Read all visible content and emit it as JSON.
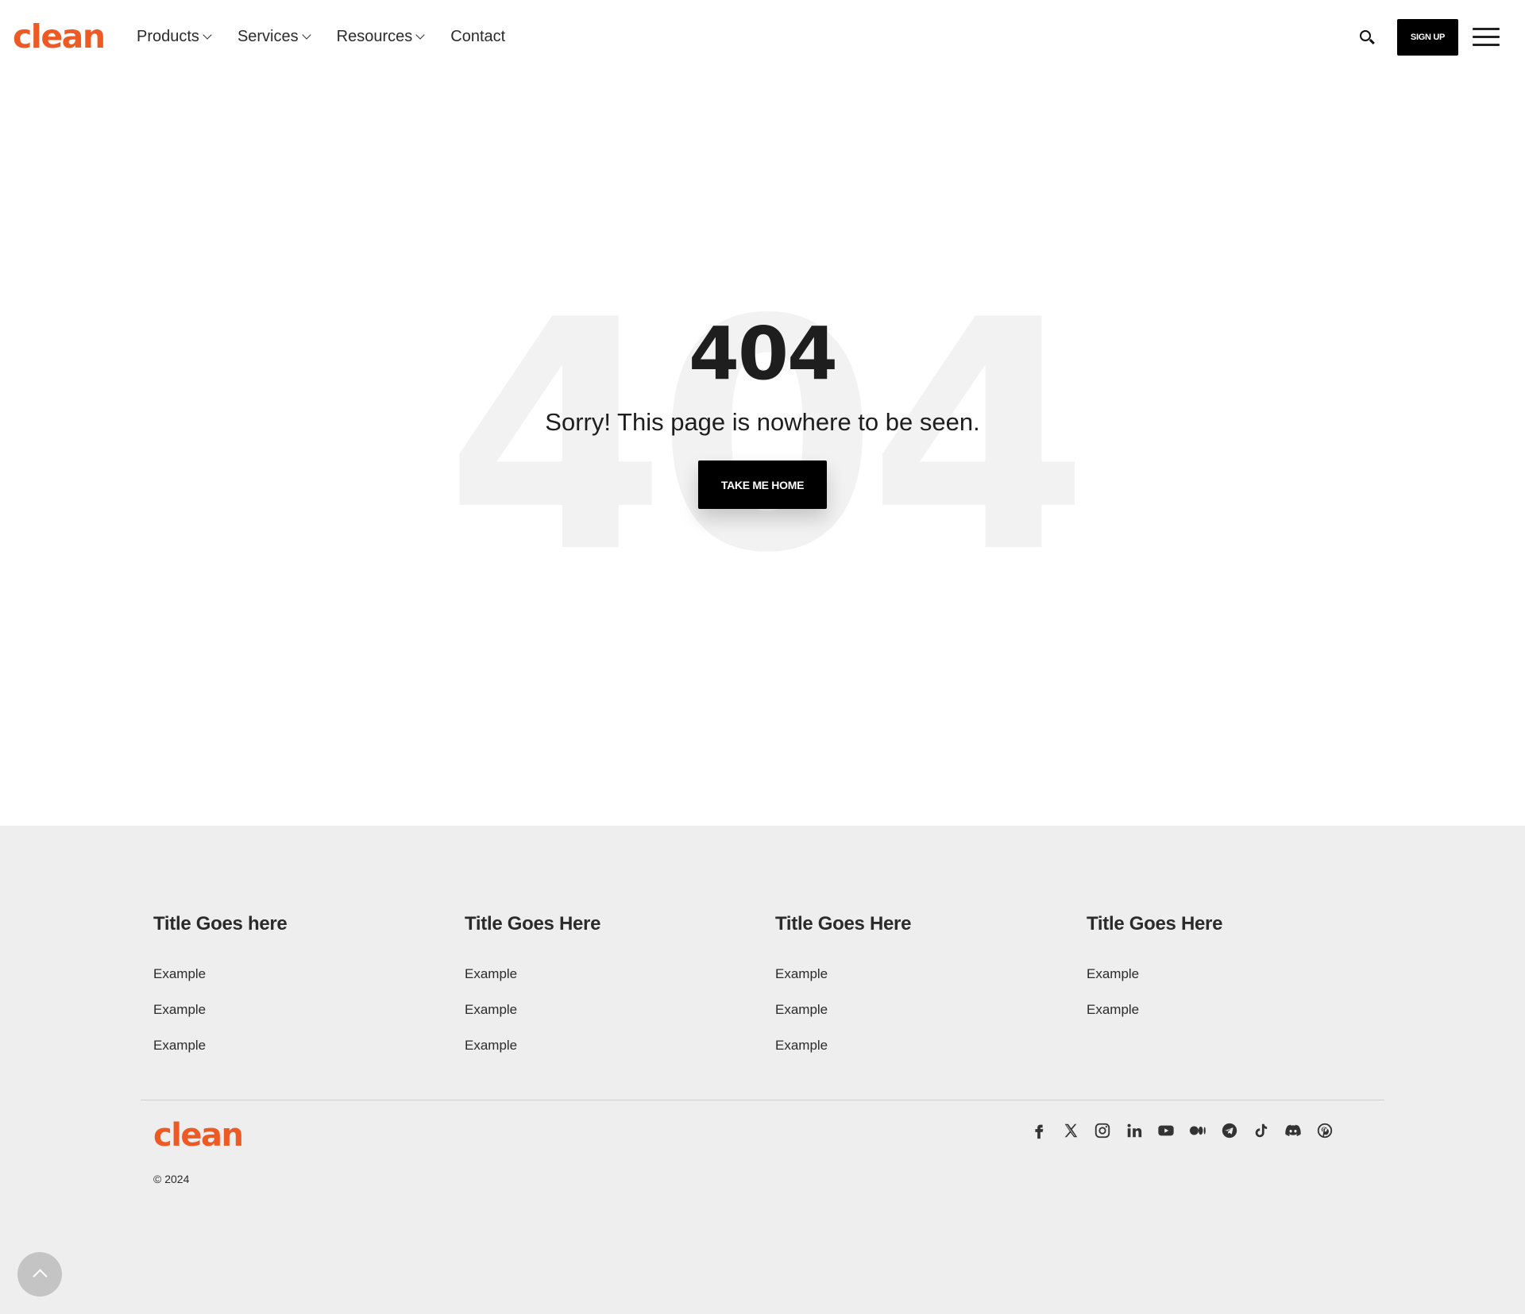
{
  "brand": {
    "logo_text": "clean",
    "color": "#ee5a24"
  },
  "nav": {
    "items": [
      {
        "label": "Products",
        "dropdown": true
      },
      {
        "label": "Services",
        "dropdown": true
      },
      {
        "label": "Resources",
        "dropdown": true
      },
      {
        "label": "Contact",
        "dropdown": false
      }
    ]
  },
  "header": {
    "signup_label": "SIGN UP"
  },
  "error": {
    "background_code": "404",
    "code": "404",
    "message": "Sorry! This page is nowhere to be seen.",
    "button_label": "TAKE ME HOME"
  },
  "footer": {
    "columns": [
      {
        "title": "Title Goes here",
        "links": [
          "Example",
          "Example",
          "Example"
        ]
      },
      {
        "title": "Title Goes Here",
        "links": [
          "Example",
          "Example",
          "Example"
        ]
      },
      {
        "title": "Title Goes Here",
        "links": [
          "Example",
          "Example",
          "Example"
        ]
      },
      {
        "title": "Title Goes Here",
        "links": [
          "Example",
          "Example"
        ]
      }
    ],
    "logo_text": "clean",
    "copyright": "© 2024",
    "social": [
      "facebook-icon",
      "x-icon",
      "instagram-icon",
      "linkedin-icon",
      "youtube-icon",
      "medium-icon",
      "telegram-icon",
      "tiktok-icon",
      "discord-icon",
      "pinterest-icon"
    ]
  }
}
